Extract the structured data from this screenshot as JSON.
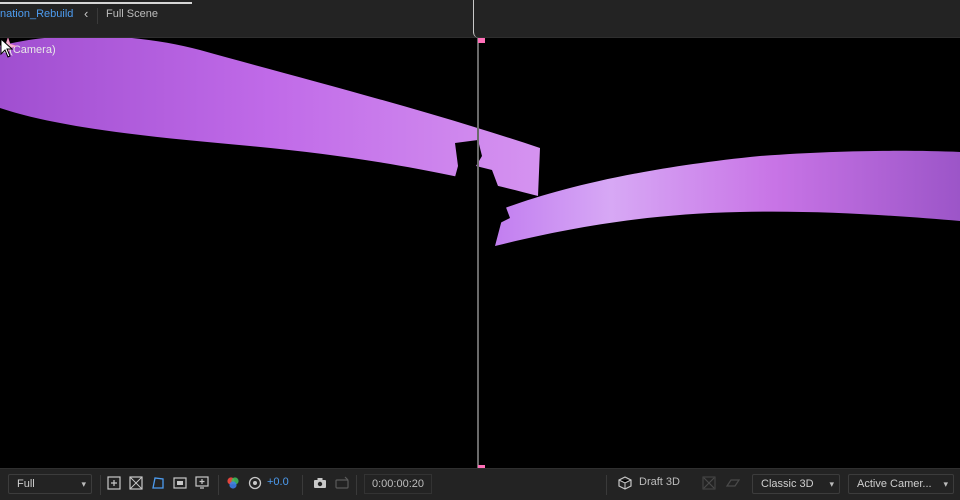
{
  "tabs": {
    "active": "nation_Rebuild",
    "arrow": "‹",
    "inactive": "Full Scene"
  },
  "viewer": {
    "camera_label": "a (Camera)",
    "ribbon_color": "#b660e0",
    "background": "#000000",
    "marker_color": "#ff6fb8"
  },
  "toolbar": {
    "resolution": "Full",
    "exposure": "+0.0",
    "timecode": "0:00:00:20",
    "draft3d": "Draft 3D",
    "renderer": "Classic 3D",
    "view": "Active Camer..."
  },
  "icons": {
    "resolution_chevron": "chevron-down-icon",
    "region": "region-of-interest-icon",
    "transparency": "transparency-grid-icon",
    "mask": "mask-path-icon",
    "guides": "grid-guides-icon",
    "channels": "color-channels-icon",
    "reset_exposure": "reset-exposure-icon",
    "snapshot": "camera-snapshot-icon",
    "show_snapshot": "show-snapshot-icon",
    "draft": "draft-3d-icon"
  }
}
